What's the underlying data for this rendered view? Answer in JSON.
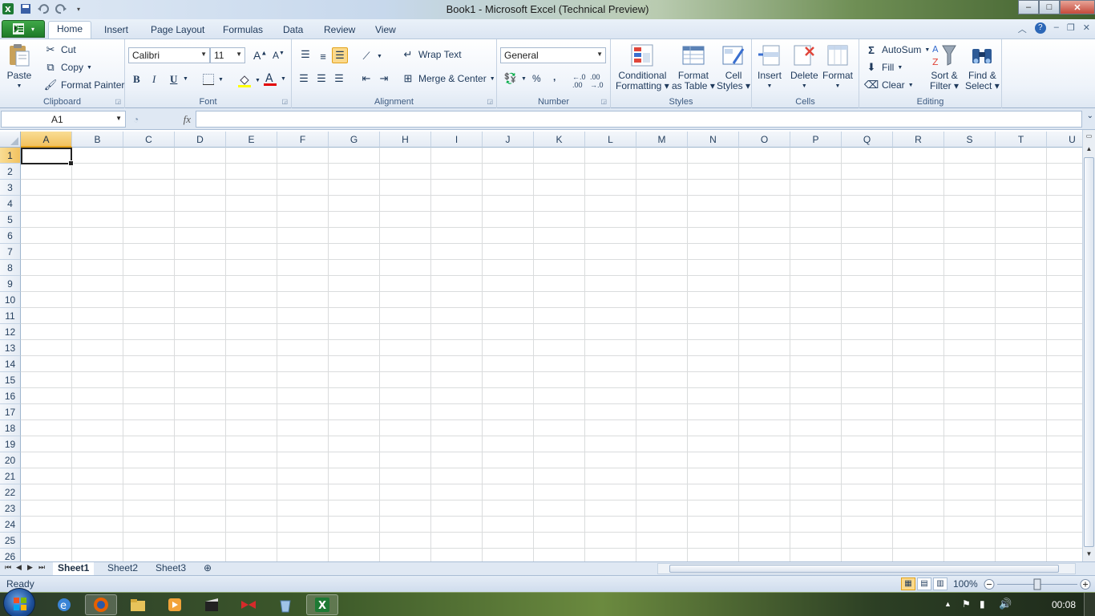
{
  "window": {
    "title": "Book1  -  Microsoft Excel (Technical Preview)",
    "controls": {
      "minimize": "–",
      "maximize": "□",
      "close": "✕"
    }
  },
  "ribbon_tabs": {
    "file_icon": "excel-logo-icon",
    "tabs": [
      "Home",
      "Insert",
      "Page Layout",
      "Formulas",
      "Data",
      "Review",
      "View"
    ],
    "active": "Home"
  },
  "clipboard": {
    "label": "Clipboard",
    "paste": "Paste",
    "cut": "Cut",
    "copy": "Copy",
    "format_painter": "Format Painter"
  },
  "font": {
    "label": "Font",
    "name": "Calibri",
    "size": "11",
    "bold": "B",
    "italic": "I",
    "underline": "U",
    "font_color": "#e30000",
    "fill_color": "#ffff00"
  },
  "alignment": {
    "label": "Alignment",
    "wrap_text": "Wrap Text",
    "merge_center": "Merge & Center"
  },
  "number": {
    "label": "Number",
    "format": "General",
    "percent": "%",
    "comma": ","
  },
  "styles": {
    "label": "Styles",
    "conditional_1": "Conditional",
    "conditional_2": "Formatting",
    "format_table_1": "Format",
    "format_table_2": "as Table",
    "cell_styles_1": "Cell",
    "cell_styles_2": "Styles"
  },
  "cells_group": {
    "label": "Cells",
    "insert": "Insert",
    "delete": "Delete",
    "format": "Format"
  },
  "editing": {
    "label": "Editing",
    "autosum": "AutoSum",
    "fill": "Fill",
    "clear": "Clear",
    "sort_1": "Sort &",
    "sort_2": "Filter",
    "find_1": "Find &",
    "find_2": "Select"
  },
  "formula_bar": {
    "name_box": "A1",
    "fx": "fx",
    "value": ""
  },
  "sheet": {
    "columns": [
      "A",
      "B",
      "C",
      "D",
      "E",
      "F",
      "G",
      "H",
      "I",
      "J",
      "K",
      "L",
      "M",
      "N",
      "O",
      "P",
      "Q",
      "R",
      "S",
      "T",
      "U"
    ],
    "rows": [
      "1",
      "2",
      "3",
      "4",
      "5",
      "6",
      "7",
      "8",
      "9",
      "10",
      "11",
      "12",
      "13",
      "14",
      "15",
      "16",
      "17",
      "18",
      "19",
      "20",
      "21",
      "22",
      "23",
      "24",
      "25",
      "26"
    ],
    "active_cell": "A1"
  },
  "sheet_tabs": {
    "tabs": [
      "Sheet1",
      "Sheet2",
      "Sheet3"
    ],
    "active": "Sheet1"
  },
  "statusbar": {
    "status": "Ready",
    "zoom": "100%",
    "zoom_out": "−",
    "zoom_in": "+"
  },
  "taskbar": {
    "clock": "00:08",
    "apps": [
      "ie-icon",
      "firefox-icon",
      "explorer-icon",
      "media-player-icon",
      "video-editor-icon",
      "bowtie-app-icon",
      "recycle-bin-icon",
      "excel-icon"
    ]
  }
}
